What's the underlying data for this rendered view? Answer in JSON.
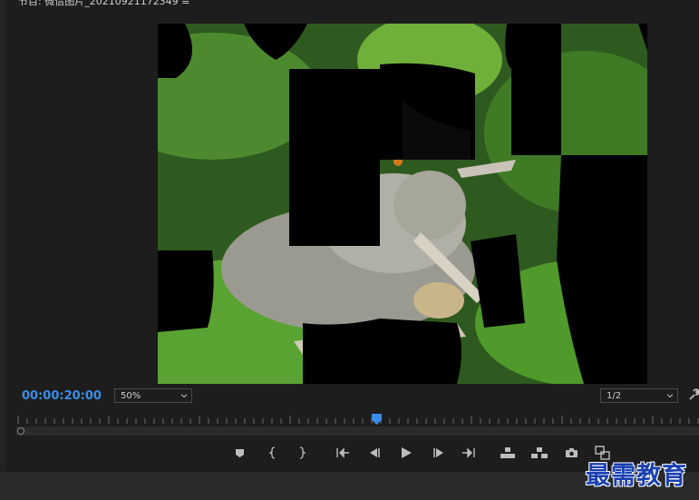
{
  "monitor": {
    "title": "节目: 微信图片_20210921172349 ≡",
    "timecode": "00:00:20:00",
    "zoom_level": "50%",
    "resolution": "1/2"
  },
  "colors": {
    "timecode": "#3a8ee8",
    "playhead": "#3a8ee8",
    "panel_bg": "#1d1d1d"
  },
  "controls": [
    {
      "name": "add-marker",
      "icon": "marker-icon"
    },
    {
      "name": "mark-in",
      "icon": "mark-in-icon"
    },
    {
      "name": "mark-out",
      "icon": "mark-out-icon"
    },
    {
      "name": "go-to-in",
      "icon": "go-to-in-icon"
    },
    {
      "name": "step-back",
      "icon": "step-back-icon"
    },
    {
      "name": "play",
      "icon": "play-icon"
    },
    {
      "name": "step-forward",
      "icon": "step-forward-icon"
    },
    {
      "name": "go-to-out",
      "icon": "go-to-out-icon"
    },
    {
      "name": "lift",
      "icon": "lift-icon"
    },
    {
      "name": "extract",
      "icon": "extract-icon"
    },
    {
      "name": "export-frame",
      "icon": "camera-icon"
    },
    {
      "name": "comparison-view",
      "icon": "comparison-view-icon"
    }
  ],
  "watermark": "最需教育"
}
